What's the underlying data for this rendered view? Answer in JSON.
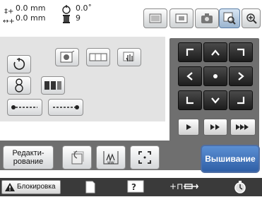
{
  "header": {
    "x_value": "0.0 mm",
    "y_value": "0.0 mm",
    "angle_value": "0.0˚",
    "count_value": "9"
  },
  "buttons": {
    "edit_label_line1": "Редакти-",
    "edit_label_line2": "рование",
    "sew_label": "Вышивание"
  },
  "statusbar": {
    "lock_label": "Блокировка"
  },
  "colors": {
    "accent_blue": "#2f5fa6",
    "panel_gray": "#6f6f6f",
    "bar_dark": "#3a3a3a"
  }
}
